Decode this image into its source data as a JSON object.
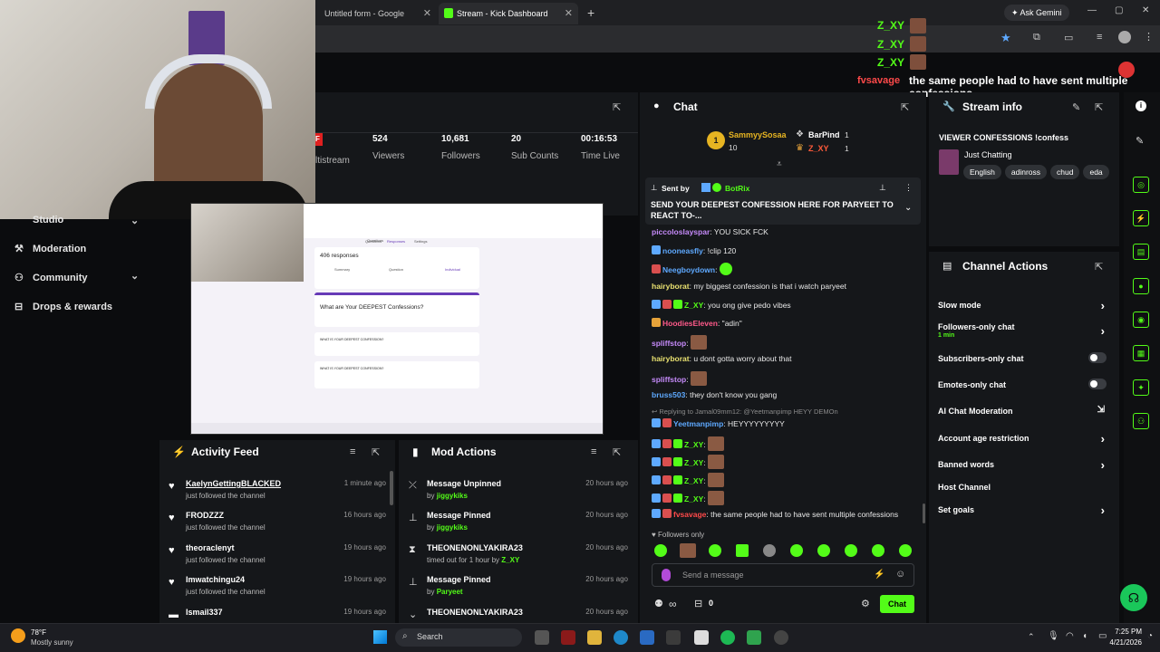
{
  "browser": {
    "tabs": [
      {
        "label": "Untitled form - Google Forms"
      },
      {
        "label": "Stream - Kick Dashboard"
      }
    ],
    "ask_gemini": "Ask Gemini"
  },
  "overlay": {
    "user": "Z_XY",
    "user_repeats": [
      "Z_XY",
      "Z_XY",
      "Z_XY"
    ],
    "alert_user": "fvsavage",
    "alert_message": "the same people had to have sent multiple confessions"
  },
  "stats": {
    "partial_label": "ltistream",
    "items": [
      {
        "value": "524",
        "label": "Viewers"
      },
      {
        "value": "10,681",
        "label": "Followers"
      },
      {
        "value": "20",
        "label": "Sub Counts"
      },
      {
        "value": "00:16:53",
        "label": "Time Live"
      }
    ]
  },
  "nav": {
    "items": [
      {
        "label": "Studio",
        "icon": "chevron-down-icon"
      },
      {
        "label": "Moderation",
        "icon": "gavel-icon"
      },
      {
        "label": "Community",
        "icon": "community-icon"
      },
      {
        "label": "Drops & rewards",
        "icon": "gift-icon"
      }
    ]
  },
  "preview": {
    "responses": "406 responses",
    "tabs": [
      "Summary",
      "Question",
      "Individual"
    ],
    "form_title": "What are Your DEEPEST Confessions?",
    "question1": "WHAT IS YOUR DEEPEST CONFESSION?",
    "question2": "WHAT IS YOUR DEEPEST CONFESSION?",
    "top_tabs": [
      "Questions",
      "Responses",
      "Settings"
    ]
  },
  "activity_feed": {
    "title": "Activity Feed",
    "rows": [
      {
        "name": "KaelynGettingBLACKED",
        "sub": "just followed the channel",
        "time": "1 minute ago"
      },
      {
        "name": "FRODZZZ",
        "sub": "just followed the channel",
        "time": "16 hours ago"
      },
      {
        "name": "theoraclenyt",
        "sub": "just followed the channel",
        "time": "19 hours ago"
      },
      {
        "name": "Imwatchingu24",
        "sub": "just followed the channel",
        "time": "19 hours ago"
      },
      {
        "name": "Ismail337",
        "sub": "",
        "time": "19 hours ago"
      }
    ]
  },
  "mod_actions": {
    "title": "Mod Actions",
    "rows": [
      {
        "name": "Message Unpinned",
        "sub": "by",
        "by": "jiggykiks",
        "time": "20 hours ago",
        "icon": "unpin-icon"
      },
      {
        "name": "Message Pinned",
        "sub": "by",
        "by": "jiggykiks",
        "time": "20 hours ago",
        "icon": "pin-icon"
      },
      {
        "name": "THEONENONLYAKIRA23",
        "sub": "timed out for 1 hour by",
        "by": "Z_XY",
        "time": "20 hours ago",
        "icon": "hourglass-icon"
      },
      {
        "name": "Message Pinned",
        "sub": "by",
        "by": "Paryeet",
        "time": "20 hours ago",
        "icon": "pin-icon"
      },
      {
        "name": "THEONENONLYAKIRA23",
        "sub": "",
        "by": "",
        "time": "20 hours ago",
        "icon": "hourglass-icon"
      }
    ]
  },
  "chat": {
    "title": "Chat",
    "top_gifters": [
      {
        "name": "SammyySosaa",
        "count": "10",
        "rank": "1"
      },
      {
        "name": "BarPind",
        "count": "1"
      },
      {
        "name": "Z_XY",
        "count": "1"
      }
    ],
    "pinned": {
      "sent_by_label": "Sent by",
      "sender": "BotRix",
      "message": "SEND YOUR DEEPEST CONFESSION HERE FOR PARYEET TO REACT TO-..."
    },
    "messages": [
      {
        "user": "piccoloslayspar",
        "color": "#c58af9",
        "text": "YOU SICK FCK"
      },
      {
        "user": "nooneasfly",
        "color": "#5ea9ff",
        "text": "!clip 120"
      },
      {
        "user": "Neegboydown",
        "color": "#5ea9ff",
        "text": ""
      },
      {
        "user": "hairyborat",
        "color": "#e8e070",
        "text": "my biggest confession is that i watch paryeet"
      },
      {
        "user": "Z_XY",
        "color": "#53fc18",
        "text": "you ong give pedo vibes"
      },
      {
        "user": "HoodiesEleven",
        "color": "#ff5a8a",
        "text": "\"adin\""
      },
      {
        "user": "spliffstop",
        "color": "#c58af9",
        "text": ""
      },
      {
        "user": "hairyborat",
        "color": "#e8e070",
        "text": "u dont gotta worry about that"
      },
      {
        "user": "spliffstop",
        "color": "#c58af9",
        "text": ""
      },
      {
        "user": "bruss503",
        "color": "#5ea9ff",
        "text": "they don't know you gang"
      },
      {
        "user": "Yeetmanpimp",
        "color": "#5ea9ff",
        "text": "HEYYYYYYYYY"
      },
      {
        "user": "Z_XY",
        "color": "#53fc18",
        "text": ""
      },
      {
        "user": "Z_XY",
        "color": "#53fc18",
        "text": ""
      },
      {
        "user": "Z_XY",
        "color": "#53fc18",
        "text": ""
      },
      {
        "user": "Z_XY",
        "color": "#53fc18",
        "text": ""
      },
      {
        "user": "fvsavage",
        "color": "#ff4a4a",
        "text": "the same people had to have sent multiple confessions"
      }
    ],
    "reply_note": "Replying to Jamal09mm12: @Yeetmanpimp HEYY DEMOn",
    "followers_only": "Followers only",
    "input_placeholder": "Send a message",
    "infinity_label": "∞",
    "points": "0",
    "send_label": "Chat"
  },
  "stream_info": {
    "title": "Stream info",
    "stream_title": "VIEWER CONFESSIONS !confess",
    "category": "Just Chatting",
    "tags": [
      "English",
      "adinross",
      "chud",
      "eda"
    ]
  },
  "channel_actions": {
    "title": "Channel Actions",
    "rows": [
      {
        "label": "Slow mode",
        "type": "chevron"
      },
      {
        "label": "Followers-only chat",
        "sub": "1 min",
        "type": "chevron"
      },
      {
        "label": "Subscribers-only chat",
        "type": "toggle"
      },
      {
        "label": "Emotes-only chat",
        "type": "toggle"
      },
      {
        "label": "AI Chat Moderation",
        "type": "external"
      },
      {
        "label": "Account age restriction",
        "type": "chevron"
      },
      {
        "label": "Banned words",
        "type": "chevron"
      },
      {
        "label": "Host Channel",
        "type": "none"
      },
      {
        "label": "Set goals",
        "type": "chevron"
      }
    ]
  },
  "taskbar": {
    "weather_temp": "78°F",
    "weather_desc": "Mostly sunny",
    "search": "Search",
    "time": "7:25 PM",
    "date": "4/21/2026"
  },
  "colors": {
    "accent": "#53fc18",
    "panel": "#15171a",
    "bg": "#0b0c0e"
  }
}
